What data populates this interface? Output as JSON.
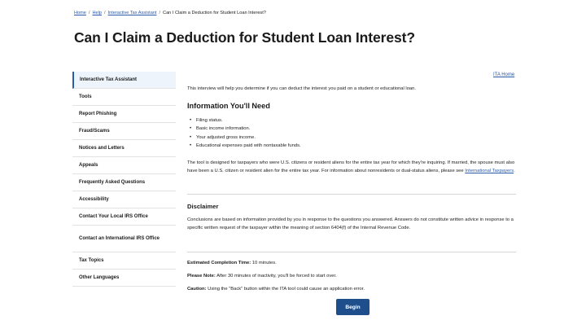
{
  "breadcrumb": {
    "items": [
      "Home",
      "Help",
      "Interactive Tax Assistant"
    ],
    "separator": "/",
    "current": "Can I Claim a Deduction for Student Loan Interest?"
  },
  "page_title": "Can I Claim a Deduction for Student Loan Interest?",
  "sidebar": {
    "items": [
      {
        "label": "Interactive Tax Assistant",
        "active": true
      },
      {
        "label": "Tools"
      },
      {
        "label": "Report Phishing"
      },
      {
        "label": "Fraud/Scams"
      },
      {
        "label": "Notices and Letters"
      },
      {
        "label": "Appeals"
      },
      {
        "label": "Frequently Asked Questions"
      },
      {
        "label": "Accessibility"
      },
      {
        "label": "Contact Your Local IRS Office"
      },
      {
        "label": "Contact an International IRS Office"
      },
      {
        "label": "Tax Topics"
      },
      {
        "label": "Other Languages"
      }
    ]
  },
  "ita_home_link": "ITA Home",
  "intro": "This interview will help you determine if you can deduct the interest you paid on a student or educational loan.",
  "info_heading": "Information You'll Need",
  "info_list": [
    "Filing status.",
    "Basic income information.",
    "Your adjusted gross income.",
    "Educational expenses paid with nontaxable funds."
  ],
  "eligibility_text": "The tool is designed for taxpayers who were U.S. citizens or resident aliens for the entire tax year for which they're inquiring. If married, the spouse must also have been a U.S. citizen or resident alien for the entire tax year. For information about nonresidents or dual-status aliens, please see",
  "eligibility_link": "International Taxpayers",
  "eligibility_end": ".",
  "disclaimer_heading": "Disclaimer",
  "disclaimer_text": "Conclusions are based on information provided by you in response to the questions you answered. Answers do not constitute written advice in response to a specific written request of the taxpayer within the meaning of section 6404(f) of the Internal Revenue Code.",
  "completion_label": "Estimated Completion Time:",
  "completion_value": "10 minutes.",
  "note_label": "Please Note:",
  "note_value": "After 30 minutes of inactivity, you'll be forced to start over.",
  "caution_label": "Caution:",
  "caution_value": "Using the \"Back\" button within the ITA tool could cause an application error.",
  "begin_label": "Begin"
}
